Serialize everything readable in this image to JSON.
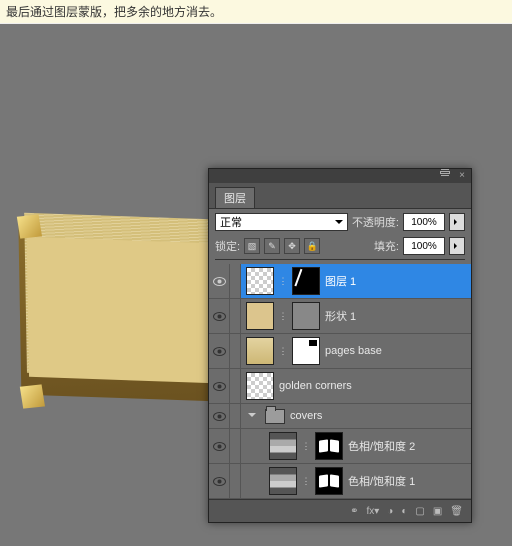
{
  "banner": "最后通过图层蒙版，把多余的地方消去。",
  "panel": {
    "tab": "图层",
    "blend_label": "正常",
    "opacity_label": "不透明度:",
    "opacity_value": "100%",
    "lock_label": "锁定:",
    "fill_label": "填充:",
    "fill_value": "100%"
  },
  "layers": [
    {
      "name": "图层 1",
      "selected": true,
      "has_mask": true
    },
    {
      "name": "形状 1",
      "has_mask": true
    },
    {
      "name": "pages base",
      "has_mask": true
    },
    {
      "name": "golden corners"
    },
    {
      "name": "covers",
      "is_group": true
    },
    {
      "name": "色相/饱和度 2",
      "is_adj": true,
      "child": true
    },
    {
      "name": "色相/饱和度 1",
      "is_adj": true,
      "child": true
    }
  ],
  "footer_icons": [
    "link",
    "fx",
    "mask",
    "adj",
    "group",
    "new",
    "trash"
  ]
}
